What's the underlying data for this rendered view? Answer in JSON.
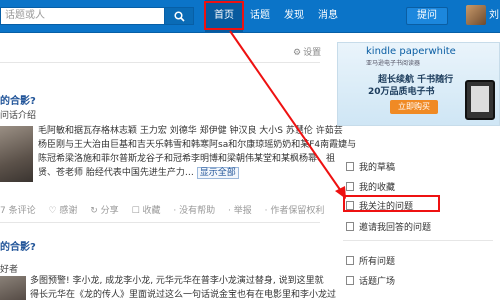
{
  "header": {
    "search_placeholder": "话题或人",
    "nav": {
      "home": "首页",
      "topic": "话题",
      "discover": "发现",
      "messages": "消息"
    },
    "ask_label": "提问",
    "username": "刘"
  },
  "main": {
    "settings_label": "设置",
    "q1_title": "的合影?",
    "q1_meta": "问话介绍",
    "q1_body_line1": "毛阿敏和据瓦存格林志颖 王力宏 刘德华 郑伊健 钟汉良 大小S 苏慧伦 许茹芸",
    "q1_body_line2": "杨臣刚与王大治由巨基和吉天乐韩雪和韩寒阿sa和尔康琼瑶奶奶和某F4南霞婕与",
    "q1_body_line3": "陈冠希梁洛施和菲尔普斯龙谷子和冠希李明博和梁朝伟某堂和某枫杨幂、祖",
    "q1_body_line4": "贤、苍老师 胎经代表中国先进生产力…",
    "q1_more": "显示全部",
    "q1_actions": [
      "7 条评论",
      "♡ 感谢",
      "↻ 分享",
      "☐ 收藏",
      "· 没有帮助",
      "· 举报",
      "· 作者保留权利"
    ],
    "q2_title": "的合影?",
    "q2_meta": "好者",
    "q2_body_line1": "多图预警! 李小龙, 成龙李小龙, 元华元华在普李小龙演过替身, 说到这里就",
    "q2_body_line2": "得长元华在《龙的传人》里面说过这么一句话说金宝也有在电影里和李小龙过"
  },
  "sidebar": {
    "ad": {
      "brand": "kindle paperwhite",
      "tagline": "亚马逊电子书阅读器",
      "line1": "超长续航 千书随行",
      "line2": "20万品质电子书",
      "button": "立即购买"
    },
    "items": [
      {
        "label": "我的草稿"
      },
      {
        "label": "我的收藏"
      },
      {
        "label": "我关注的问题"
      },
      {
        "label": "邀请我回答的问题"
      },
      {
        "label": "所有问题"
      },
      {
        "label": "话题广场"
      }
    ]
  },
  "colors": {
    "topbar": "#0b74c8",
    "highlight": "#e11111",
    "link": "#225599"
  }
}
